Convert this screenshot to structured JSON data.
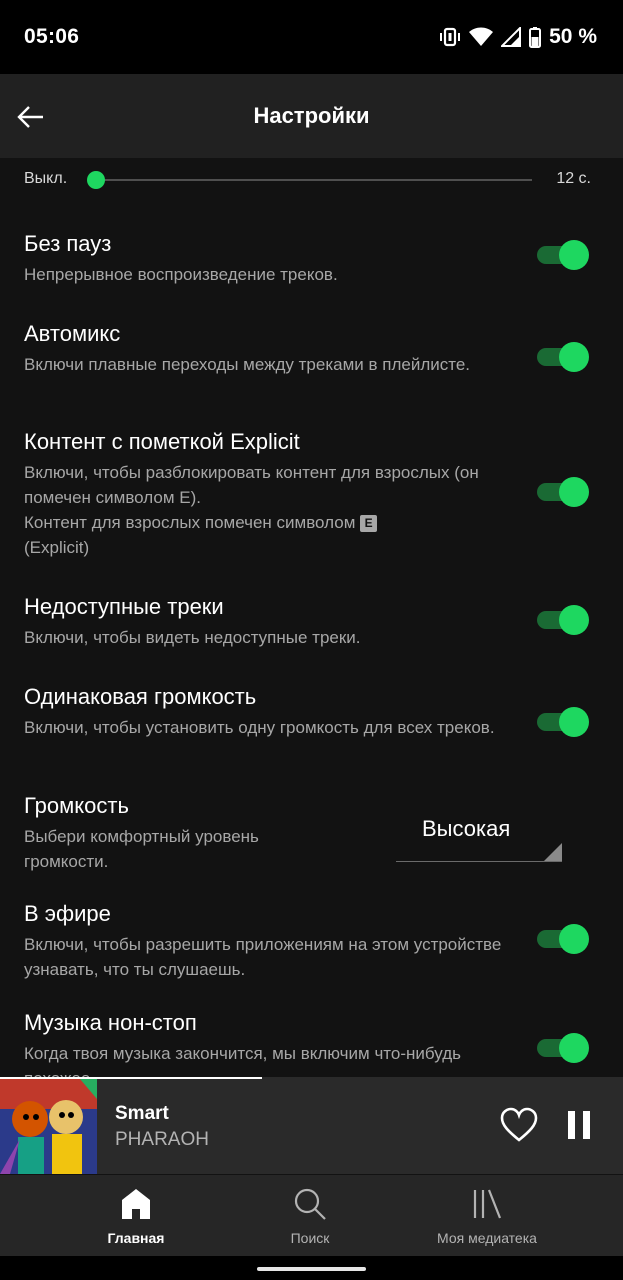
{
  "status": {
    "time": "05:06",
    "battery": "50 %"
  },
  "header": {
    "title": "Настройки"
  },
  "crossfade": {
    "min_label": "Выкл.",
    "max_label": "12 с.",
    "level": 0.0
  },
  "settings": [
    {
      "title": "Без пауз",
      "desc": "Непрерывное воспроизведение треков.",
      "enabled": true
    },
    {
      "title": "Автомикс",
      "desc": "Включи плавные переходы между треками в плейлисте.",
      "enabled": true
    },
    {
      "title": "Контент с пометкой Explicit",
      "desc": "Включи, чтобы разблокировать контент для взрослых (он помечен символом E).",
      "desc2": "Контент для взрослых помечен символом",
      "badge": "E",
      "desc3": "(Explicit)",
      "enabled": true
    },
    {
      "title": "Недоступные треки",
      "desc": "Включи, чтобы видеть недоступные треки.",
      "enabled": true
    },
    {
      "title": "Одинаковая громкость",
      "desc": "Включи, чтобы установить одну громкость для всех треков.",
      "enabled": true
    },
    {
      "title": "Громкость",
      "desc": "Выбери комфортный уровень громкости.",
      "value": "Высокая"
    },
    {
      "title": "В эфире",
      "desc": "Включи, чтобы разрешить приложениям на этом устройстве узнавать, что ты слушаешь.",
      "enabled": true
    },
    {
      "title": "Музыка нон-стоп",
      "desc": "Когда твоя музыка закончится, мы включим что-нибудь похожее.",
      "enabled": true
    }
  ],
  "player": {
    "song": "Smart",
    "artist": "PHARAOH",
    "progress": 0.42
  },
  "tabs": [
    {
      "label": "Главная",
      "icon": "home-icon",
      "active": true
    },
    {
      "label": "Поиск",
      "icon": "search-icon",
      "active": false
    },
    {
      "label": "Моя медиатека",
      "icon": "library-icon",
      "active": false
    }
  ],
  "colors": {
    "accent": "#1ed760",
    "background": "#121212",
    "header": "#212121"
  }
}
